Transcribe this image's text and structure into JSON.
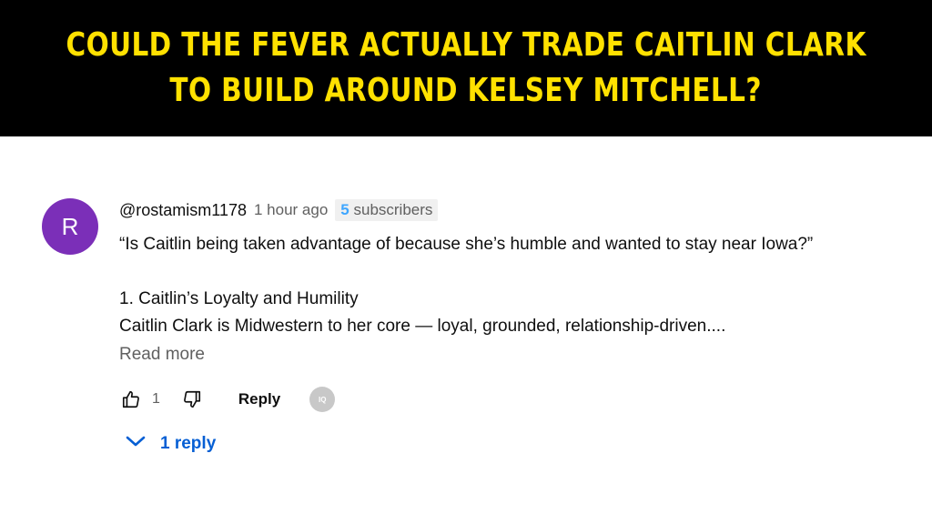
{
  "banner": {
    "line1": "COULD THE FEVER ACTUALLY TRADE CAITLIN CLARK",
    "line2": "TO BUILD AROUND KELSEY MITCHELL?"
  },
  "comment": {
    "avatar_letter": "R",
    "handle": "@rostamism1178",
    "time": "1 hour ago",
    "subscribers_count": "5",
    "subscribers_label": "subscribers",
    "lines": [
      "“Is Caitlin being taken advantage of because she’s humble and wanted to stay near Iowa?”",
      "",
      "1. Caitlin’s Loyalty and Humility",
      "Caitlin Clark is Midwestern to her core — loyal, grounded, relationship-driven...."
    ],
    "read_more": "Read more",
    "likes": "1",
    "reply_label": "Reply",
    "creator_heart_text": "IQ",
    "replies_label": "1 reply"
  },
  "icons": {
    "like": "thumbs-up-icon",
    "dislike": "thumbs-down-icon",
    "replies": "chevron-down-icon"
  },
  "colors": {
    "banner_bg": "#000000",
    "banner_text": "#ffe100",
    "avatar_bg": "#7b2fb8",
    "link_blue": "#065fd4",
    "subs_blue": "#3ea6ff"
  }
}
